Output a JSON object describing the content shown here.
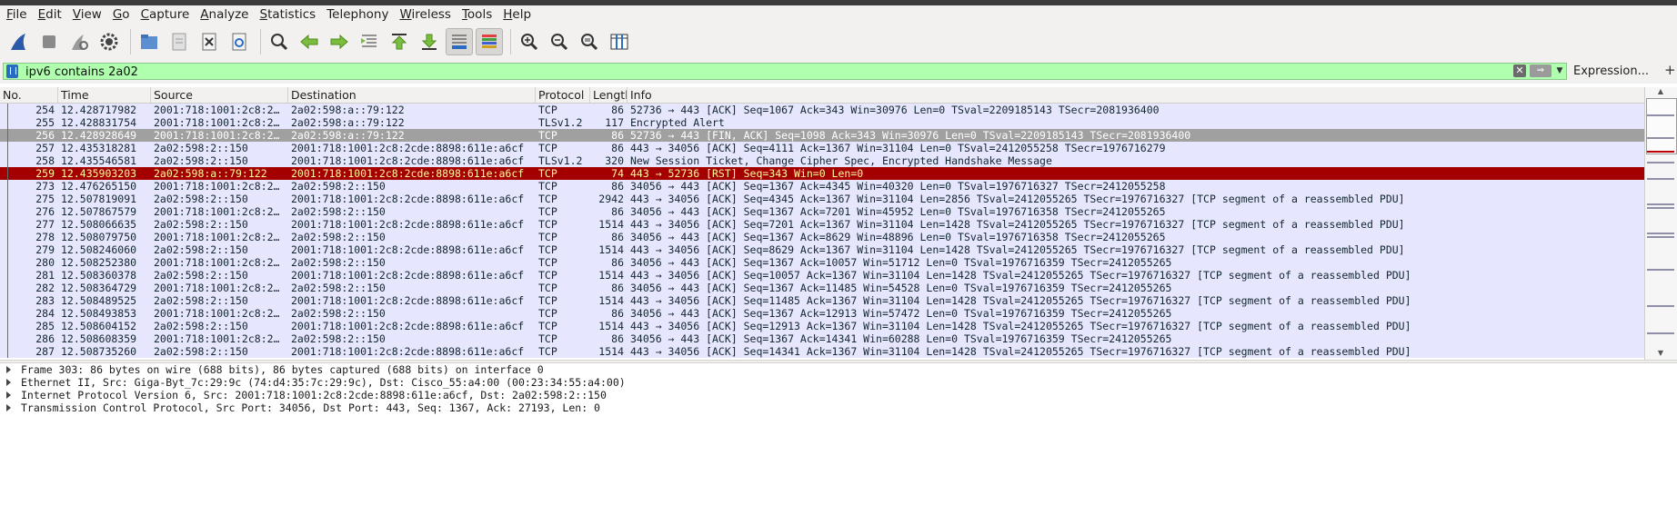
{
  "menu": [
    {
      "u": "F",
      "rest": "ile"
    },
    {
      "u": "E",
      "rest": "dit"
    },
    {
      "u": "V",
      "rest": "iew"
    },
    {
      "u": "G",
      "rest": "o"
    },
    {
      "u": "C",
      "rest": "apture"
    },
    {
      "u": "A",
      "rest": "nalyze"
    },
    {
      "u": "S",
      "rest": "tatistics"
    },
    {
      "u": "",
      "rest": "Telephony"
    },
    {
      "u": "W",
      "rest": "ireless"
    },
    {
      "u": "T",
      "rest": "ools"
    },
    {
      "u": "H",
      "rest": "elp"
    }
  ],
  "toolbar_icons": [
    "shark-fin-start-icon",
    "stop-capture-icon",
    "restart-capture-icon",
    "capture-options-icon",
    "open-file-icon",
    "save-file-icon",
    "close-file-icon",
    "reload-file-icon",
    "find-packet-icon",
    "go-back-icon",
    "go-forward-icon",
    "go-to-packet-icon",
    "first-packet-icon",
    "last-packet-icon",
    "autoscroll-icon",
    "colorize-icon",
    "zoom-in-icon",
    "zoom-out-icon",
    "zoom-normal-icon",
    "resize-columns-icon"
  ],
  "filter": {
    "value": "ipv6 contains 2a02",
    "expression_label": "Expression...",
    "add_label": "+"
  },
  "columns": [
    "No.",
    "Time",
    "Source",
    "Destination",
    "Protocol",
    "Length",
    "Info"
  ],
  "packets": [
    {
      "no": "254",
      "time": "12.428717982",
      "src": "2001:718:1001:2c8:2…",
      "dst": "2a02:598:a::79:122",
      "proto": "TCP",
      "len": "86",
      "info": "52736 → 443 [ACK] Seq=1067 Ack=343 Win=30976 Len=0 TSval=2209185143 TSecr=2081936400",
      "style": "normal"
    },
    {
      "no": "255",
      "time": "12.428831754",
      "src": "2001:718:1001:2c8:2…",
      "dst": "2a02:598:a::79:122",
      "proto": "TLSv1.2",
      "len": "117",
      "info": "Encrypted Alert",
      "style": "normal"
    },
    {
      "no": "256",
      "time": "12.428928649",
      "src": "2001:718:1001:2c8:2…",
      "dst": "2a02:598:a::79:122",
      "proto": "TCP",
      "len": "86",
      "info": "52736 → 443 [FIN, ACK] Seq=1098 Ack=343 Win=30976 Len=0 TSval=2209185143 TSecr=2081936400",
      "style": "sel"
    },
    {
      "no": "257",
      "time": "12.435318281",
      "src": "2a02:598:2::150",
      "dst": "2001:718:1001:2c8:2cde:8898:611e:a6cf",
      "proto": "TCP",
      "len": "86",
      "info": "443 → 34056 [ACK] Seq=4111 Ack=1367 Win=31104 Len=0 TSval=2412055258 TSecr=1976716279",
      "style": "normal"
    },
    {
      "no": "258",
      "time": "12.435546581",
      "src": "2a02:598:2::150",
      "dst": "2001:718:1001:2c8:2cde:8898:611e:a6cf",
      "proto": "TLSv1.2",
      "len": "320",
      "info": "New Session Ticket, Change Cipher Spec, Encrypted Handshake Message",
      "style": "normal"
    },
    {
      "no": "259",
      "time": "12.435903203",
      "src": "2a02:598:a::79:122",
      "dst": "2001:718:1001:2c8:2cde:8898:611e:a6cf",
      "proto": "TCP",
      "len": "74",
      "info": "443 → 52736 [RST] Seq=343 Win=0 Len=0",
      "style": "rst"
    },
    {
      "no": "273",
      "time": "12.476265150",
      "src": "2001:718:1001:2c8:2…",
      "dst": "2a02:598:2::150",
      "proto": "TCP",
      "len": "86",
      "info": "34056 → 443 [ACK] Seq=1367 Ack=4345 Win=40320 Len=0 TSval=1976716327 TSecr=2412055258",
      "style": "normal"
    },
    {
      "no": "275",
      "time": "12.507819091",
      "src": "2a02:598:2::150",
      "dst": "2001:718:1001:2c8:2cde:8898:611e:a6cf",
      "proto": "TCP",
      "len": "2942",
      "info": "443 → 34056 [ACK] Seq=4345 Ack=1367 Win=31104 Len=2856 TSval=2412055265 TSecr=1976716327 [TCP segment of a reassembled PDU]",
      "style": "normal"
    },
    {
      "no": "276",
      "time": "12.507867579",
      "src": "2001:718:1001:2c8:2…",
      "dst": "2a02:598:2::150",
      "proto": "TCP",
      "len": "86",
      "info": "34056 → 443 [ACK] Seq=1367 Ack=7201 Win=45952 Len=0 TSval=1976716358 TSecr=2412055265",
      "style": "normal"
    },
    {
      "no": "277",
      "time": "12.508066635",
      "src": "2a02:598:2::150",
      "dst": "2001:718:1001:2c8:2cde:8898:611e:a6cf",
      "proto": "TCP",
      "len": "1514",
      "info": "443 → 34056 [ACK] Seq=7201 Ack=1367 Win=31104 Len=1428 TSval=2412055265 TSecr=1976716327 [TCP segment of a reassembled PDU]",
      "style": "normal"
    },
    {
      "no": "278",
      "time": "12.508079750",
      "src": "2001:718:1001:2c8:2…",
      "dst": "2a02:598:2::150",
      "proto": "TCP",
      "len": "86",
      "info": "34056 → 443 [ACK] Seq=1367 Ack=8629 Win=48896 Len=0 TSval=1976716358 TSecr=2412055265",
      "style": "normal"
    },
    {
      "no": "279",
      "time": "12.508246060",
      "src": "2a02:598:2::150",
      "dst": "2001:718:1001:2c8:2cde:8898:611e:a6cf",
      "proto": "TCP",
      "len": "1514",
      "info": "443 → 34056 [ACK] Seq=8629 Ack=1367 Win=31104 Len=1428 TSval=2412055265 TSecr=1976716327 [TCP segment of a reassembled PDU]",
      "style": "normal"
    },
    {
      "no": "280",
      "time": "12.508252380",
      "src": "2001:718:1001:2c8:2…",
      "dst": "2a02:598:2::150",
      "proto": "TCP",
      "len": "86",
      "info": "34056 → 443 [ACK] Seq=1367 Ack=10057 Win=51712 Len=0 TSval=1976716359 TSecr=2412055265",
      "style": "normal"
    },
    {
      "no": "281",
      "time": "12.508360378",
      "src": "2a02:598:2::150",
      "dst": "2001:718:1001:2c8:2cde:8898:611e:a6cf",
      "proto": "TCP",
      "len": "1514",
      "info": "443 → 34056 [ACK] Seq=10057 Ack=1367 Win=31104 Len=1428 TSval=2412055265 TSecr=1976716327 [TCP segment of a reassembled PDU]",
      "style": "normal"
    },
    {
      "no": "282",
      "time": "12.508364729",
      "src": "2001:718:1001:2c8:2…",
      "dst": "2a02:598:2::150",
      "proto": "TCP",
      "len": "86",
      "info": "34056 → 443 [ACK] Seq=1367 Ack=11485 Win=54528 Len=0 TSval=1976716359 TSecr=2412055265",
      "style": "normal"
    },
    {
      "no": "283",
      "time": "12.508489525",
      "src": "2a02:598:2::150",
      "dst": "2001:718:1001:2c8:2cde:8898:611e:a6cf",
      "proto": "TCP",
      "len": "1514",
      "info": "443 → 34056 [ACK] Seq=11485 Ack=1367 Win=31104 Len=1428 TSval=2412055265 TSecr=1976716327 [TCP segment of a reassembled PDU]",
      "style": "normal"
    },
    {
      "no": "284",
      "time": "12.508493853",
      "src": "2001:718:1001:2c8:2…",
      "dst": "2a02:598:2::150",
      "proto": "TCP",
      "len": "86",
      "info": "34056 → 443 [ACK] Seq=1367 Ack=12913 Win=57472 Len=0 TSval=1976716359 TSecr=2412055265",
      "style": "normal"
    },
    {
      "no": "285",
      "time": "12.508604152",
      "src": "2a02:598:2::150",
      "dst": "2001:718:1001:2c8:2cde:8898:611e:a6cf",
      "proto": "TCP",
      "len": "1514",
      "info": "443 → 34056 [ACK] Seq=12913 Ack=1367 Win=31104 Len=1428 TSval=2412055265 TSecr=1976716327 [TCP segment of a reassembled PDU]",
      "style": "normal"
    },
    {
      "no": "286",
      "time": "12.508608359",
      "src": "2001:718:1001:2c8:2…",
      "dst": "2a02:598:2::150",
      "proto": "TCP",
      "len": "86",
      "info": "34056 → 443 [ACK] Seq=1367 Ack=14341 Win=60288 Len=0 TSval=1976716359 TSecr=2412055265",
      "style": "normal"
    },
    {
      "no": "287",
      "time": "12.508735260",
      "src": "2a02:598:2::150",
      "dst": "2001:718:1001:2c8:2cde:8898:611e:a6cf",
      "proto": "TCP",
      "len": "1514",
      "info": "443 → 34056 [ACK] Seq=14341 Ack=1367 Win=31104 Len=1428 TSval=2412055265 TSecr=1976716327 [TCP segment of a reassembled PDU]",
      "style": "normal"
    }
  ],
  "details": [
    "Frame 303: 86 bytes on wire (688 bits), 86 bytes captured (688 bits) on interface 0",
    "Ethernet II, Src: Giga-Byt_7c:29:9c (74:d4:35:7c:29:9c), Dst: Cisco_55:a4:00 (00:23:34:55:a4:00)",
    "Internet Protocol Version 6, Src: 2001:718:1001:2c8:2cde:8898:611e:a6cf, Dst: 2a02:598:2::150",
    "Transmission Control Protocol, Src Port: 34056, Dst Port: 443, Seq: 1367, Ack: 27193, Len: 0"
  ],
  "colors": {
    "row_tcp": "#e7e6ff",
    "row_selected": "#a0a0a0",
    "row_rst_bg": "#a40000",
    "row_rst_fg": "#fffc9c",
    "filter_valid": "#afffaf"
  }
}
